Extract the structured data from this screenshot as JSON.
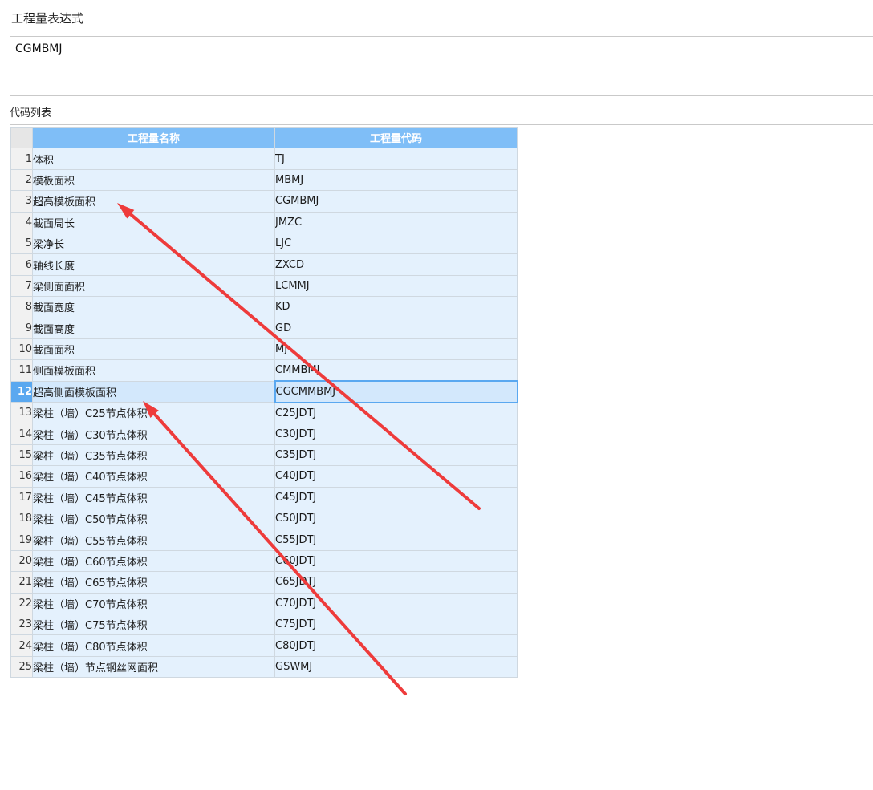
{
  "expression": {
    "label": "工程量表达式",
    "value": "CGMBMJ"
  },
  "code_list": {
    "label": "代码列表",
    "headers": {
      "name": "工程量名称",
      "code": "工程量代码"
    },
    "selected_row": 12,
    "rows": [
      {
        "index": "1",
        "name": "体积",
        "code": "TJ"
      },
      {
        "index": "2",
        "name": "模板面积",
        "code": "MBMJ"
      },
      {
        "index": "3",
        "name": "超高模板面积",
        "code": "CGMBMJ"
      },
      {
        "index": "4",
        "name": "截面周长",
        "code": "JMZC"
      },
      {
        "index": "5",
        "name": "梁净长",
        "code": "LJC"
      },
      {
        "index": "6",
        "name": "轴线长度",
        "code": "ZXCD"
      },
      {
        "index": "7",
        "name": "梁侧面面积",
        "code": "LCMMJ"
      },
      {
        "index": "8",
        "name": "截面宽度",
        "code": "KD"
      },
      {
        "index": "9",
        "name": "截面高度",
        "code": "GD"
      },
      {
        "index": "10",
        "name": "截面面积",
        "code": "MJ"
      },
      {
        "index": "11",
        "name": "侧面模板面积",
        "code": "CMMBMJ"
      },
      {
        "index": "12",
        "name": "超高侧面模板面积",
        "code": "CGCMMBMJ"
      },
      {
        "index": "13",
        "name": "梁柱（墙）C25节点体积",
        "code": "C25JDTJ"
      },
      {
        "index": "14",
        "name": "梁柱（墙）C30节点体积",
        "code": "C30JDTJ"
      },
      {
        "index": "15",
        "name": "梁柱（墙）C35节点体积",
        "code": "C35JDTJ"
      },
      {
        "index": "16",
        "name": "梁柱（墙）C40节点体积",
        "code": "C40JDTJ"
      },
      {
        "index": "17",
        "name": "梁柱（墙）C45节点体积",
        "code": "C45JDTJ"
      },
      {
        "index": "18",
        "name": "梁柱（墙）C50节点体积",
        "code": "C50JDTJ"
      },
      {
        "index": "19",
        "name": "梁柱（墙）C55节点体积",
        "code": "C55JDTJ"
      },
      {
        "index": "20",
        "name": "梁柱（墙）C60节点体积",
        "code": "C60JDTJ"
      },
      {
        "index": "21",
        "name": "梁柱（墙）C65节点体积",
        "code": "C65JDTJ"
      },
      {
        "index": "22",
        "name": "梁柱（墙）C70节点体积",
        "code": "C70JDTJ"
      },
      {
        "index": "23",
        "name": "梁柱（墙）C75节点体积",
        "code": "C75JDTJ"
      },
      {
        "index": "24",
        "name": "梁柱（墙）C80节点体积",
        "code": "C80JDTJ"
      },
      {
        "index": "25",
        "name": "梁柱（墙）节点钢丝网面积",
        "code": "GSWMJ"
      }
    ]
  },
  "annotations": {
    "arrow_color": "#ee3b3b",
    "arrow_icon": "red-annotation-arrow-icon"
  }
}
